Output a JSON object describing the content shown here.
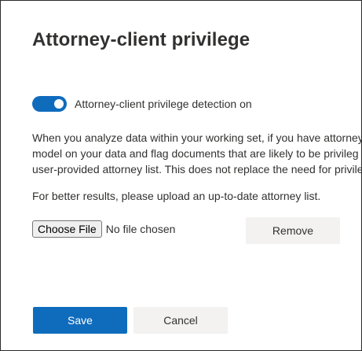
{
  "panel": {
    "title": "Attorney-client privilege"
  },
  "toggle": {
    "label": "Attorney-client privilege detection on",
    "state": "on",
    "color": "#0f6cbd"
  },
  "description": {
    "lines": [
      "When you analyze data within your working set, if you have attorney",
      "model on your data and flag documents that are likely to be privileg",
      "user-provided attorney list. This does not replace the need for privile"
    ]
  },
  "note": "For better results, please upload an up-to-date attorney list.",
  "file_input": {
    "button_label": "Choose File",
    "status": "No file chosen"
  },
  "actions": {
    "remove_label": "Remove",
    "save_label": "Save",
    "cancel_label": "Cancel",
    "primary_color": "#0f6cbd"
  }
}
